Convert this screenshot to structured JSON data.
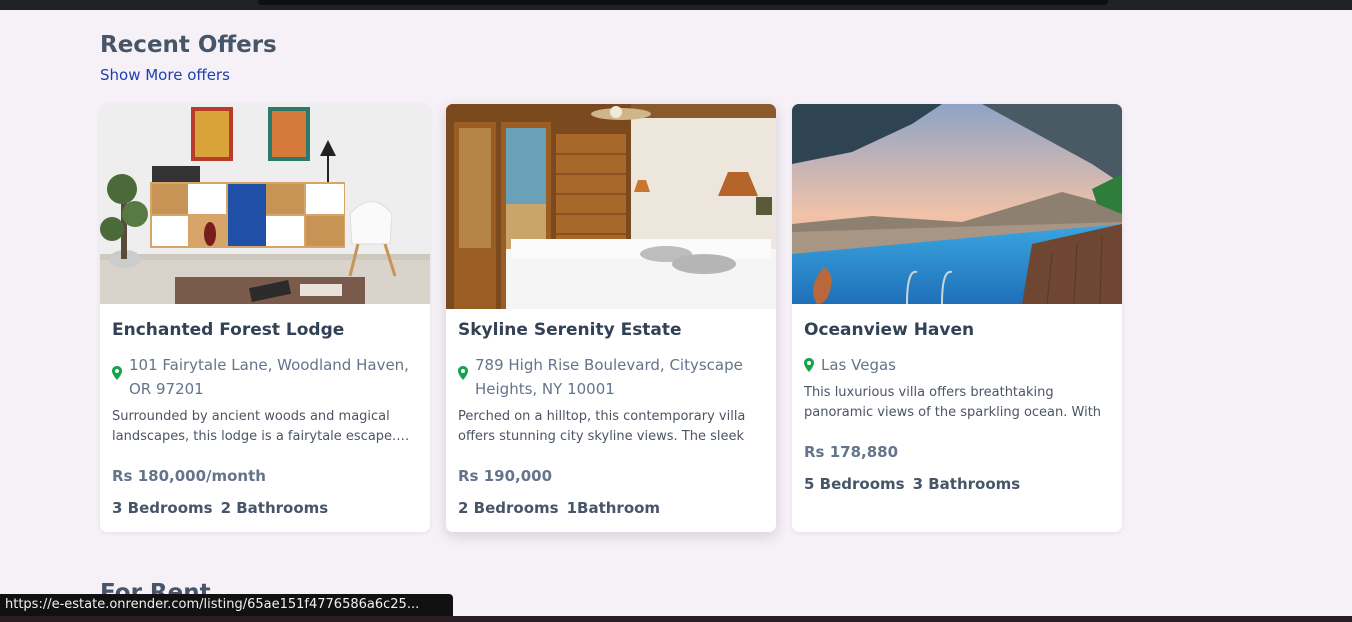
{
  "section": {
    "title": "Recent Offers",
    "show_more": "Show More offers",
    "next_title": "For Rent"
  },
  "listings": [
    {
      "title": "Enchanted Forest Lodge",
      "address": "101 Fairytale Lane, Woodland Haven, OR 97201",
      "description": "Surrounded by ancient woods and magical landscapes, this lodge is a fairytale escape. The",
      "price": "Rs 180,000/month",
      "bedrooms": "3 Bedrooms",
      "bathrooms": "2 Bathrooms",
      "image": "living-room-photo"
    },
    {
      "title": "Skyline Serenity Estate",
      "address": "789 High Rise Boulevard, Cityscape Heights, NY 10001",
      "description": "Perched on a hilltop, this contemporary villa offers stunning city skyline views. The sleek",
      "price": "Rs 190,000",
      "bedrooms": "2 Bedrooms",
      "bathrooms": "1Bathroom",
      "image": "bedroom-photo"
    },
    {
      "title": "Oceanview Haven",
      "address": "Las Vegas",
      "description": "This luxurious villa offers breathtaking panoramic views of the sparkling ocean. With",
      "price": "Rs 178,880",
      "bedrooms": "5 Bedrooms",
      "bathrooms": "3 Bathrooms",
      "image": "infinity-pool-photo"
    }
  ],
  "status_bar": {
    "url": "https://e-estate.onrender.com/listing/65ae151f4776586a6c25..."
  },
  "colors": {
    "background": "#f5f1f7",
    "link": "#1e40af",
    "pin": "#16a34a"
  }
}
